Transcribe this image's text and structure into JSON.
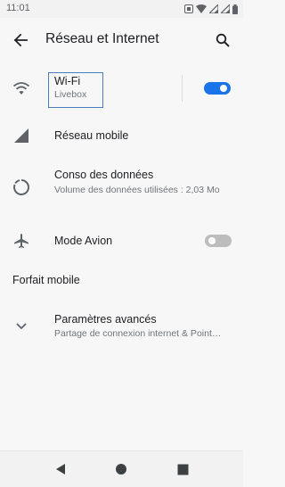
{
  "status_bar": {
    "time": "11:01",
    "icons": [
      "notification-icon",
      "wifi-signal-icon",
      "cell-signal-icon",
      "cell-signal-icon",
      "battery-icon"
    ]
  },
  "app_bar": {
    "title": "Réseau et Internet",
    "back_icon": "arrow-back-icon",
    "search_icon": "search-icon"
  },
  "rows": {
    "wifi": {
      "title": "Wi-Fi",
      "subtitle": "Livebox",
      "icon": "wifi-icon",
      "toggle_on": true
    },
    "mobile": {
      "title": "Réseau mobile",
      "icon": "signal-icon"
    },
    "data": {
      "title": "Conso des données",
      "subtitle": "Volume des données utilisées : 2,03 Mo",
      "icon": "data-usage-icon"
    },
    "airplane": {
      "title": "Mode Avion",
      "icon": "airplane-icon",
      "toggle_on": false
    },
    "advanced": {
      "title": "Paramètres avancés",
      "subtitle": "Partage de connexion internet & Point…",
      "icon": "chevron-down-icon"
    }
  },
  "sections": {
    "forfait": "Forfait mobile"
  },
  "nav_bar": {
    "icons": [
      "back-triangle-icon",
      "home-circle-icon",
      "recents-square-icon"
    ]
  },
  "colors": {
    "accent": "#1a73e8",
    "highlight_border": "#4a7dbd",
    "background": "#f7f7f7"
  }
}
